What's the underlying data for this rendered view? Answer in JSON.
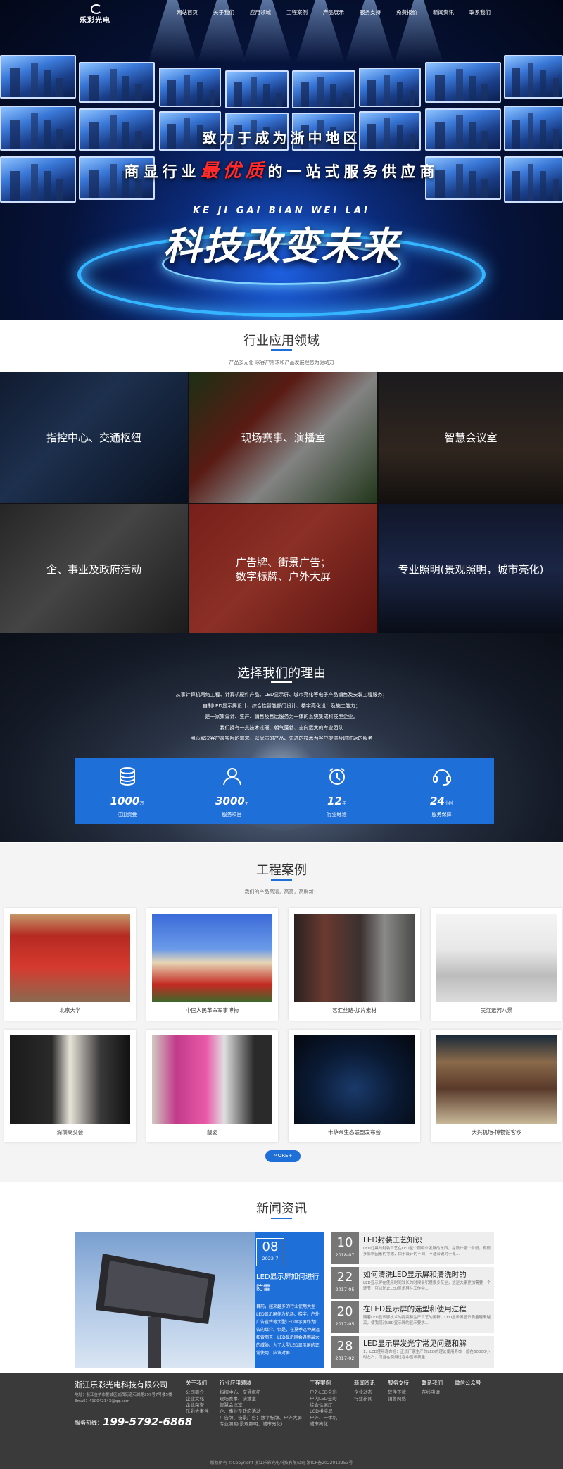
{
  "nav": {
    "logo": "乐彩光电",
    "items": [
      "网站首页",
      "关于我们",
      "应用领域",
      "工程案例",
      "产品展示",
      "服务支持",
      "免费报价",
      "新闻资讯",
      "联系我们"
    ]
  },
  "hero": {
    "line1": "致力于成为浙中地区",
    "line2_pre": "商显行业",
    "line2_hl": "最优质",
    "line2_post": "的一站式服务供应商",
    "pinyin": "KE JI GAI BIAN WEI LAI",
    "big": "科技改变未来"
  },
  "apps": {
    "title": "行业应用领域",
    "subtitle": "产品多元化 以客户需求和产品发展理念为驱动力",
    "tiles": [
      {
        "label": "指控中心、交通枢纽"
      },
      {
        "label": "现场赛事、演播室"
      },
      {
        "label": "智慧会议室"
      },
      {
        "label": "企、事业及政府活动"
      },
      {
        "label_1": "广告牌、街景广告；",
        "label_2": "数字标牌、户外大屏"
      },
      {
        "label": "专业照明(景观照明，城市亮化)"
      }
    ]
  },
  "why": {
    "title": "选择我们的理由",
    "lines": [
      "从事计算机网络工程、计算机硬件产品、LED显示屏、城市亮化等电子产品销售及安装工程服务；",
      "自制LED显示屏设计、综合性智能部门设计、楼宇亮化设计及施工能力；",
      "是一家集设计、生产、销售及售后服务为一体的系统集成科技型企业。",
      "我们拥有一支技术过硬、朝气蓬勃、志向远大的专业团队",
      "用心解决客户最实际的需求，以优质的产品、先进的技术为客户提供及时往返的服务"
    ],
    "stats": [
      {
        "num": "1000",
        "unit": "万",
        "label": "注册资金",
        "icon": "coins-icon"
      },
      {
        "num": "3000",
        "unit": "+",
        "label": "服务项目",
        "icon": "users-icon"
      },
      {
        "num": "12",
        "unit": "年",
        "label": "行业经验",
        "icon": "clock-icon"
      },
      {
        "num": "24",
        "unit": "小时",
        "label": "服务保障",
        "icon": "support-icon"
      }
    ]
  },
  "cases": {
    "title": "工程案例",
    "subtitle": "我们的产品高清，高亮，高刷新！",
    "items": [
      "北京大学",
      "中国人民革命军事博物",
      "艺汇丝路-加片素材",
      "吴江运河八景",
      "深圳高交会",
      "靓姿",
      "卡萨帝生态联盟发布会",
      "大兴机场-博物馆客移"
    ],
    "more": "MORE+"
  },
  "news": {
    "title": "新闻资讯",
    "feature": {
      "day": "08",
      "ym": "2022-7",
      "title": "LED显示屏如何进行防雷",
      "desc": "目前，越来越多的行业使用大型LED显示屏作为机场、楼宇、户外广告宣传等大型LED显示屏作为广告的媒介。但是，在夏季这种高温和雷雨天，LED显示屏会遇到最大的威胁。为了大型LED显示屏的正常使用，应该对屏..."
    },
    "list": [
      {
        "day": "10",
        "ym": "2018-07",
        "title": "LED封装工艺知识",
        "desc": "LED灯具的封装工艺在LED整个照明业发展的东西，在设计哪个阶段，有很多影响因素的考虑，由于设计的不同，不适合说对于某..."
      },
      {
        "day": "22",
        "ym": "2017-05",
        "title": "如何清洗LED显示屏和清洗时的",
        "desc": "LED显示屏在使用时间较长的时候会积攒很多灰尘，这是大家更加需要一个环节，可以防止LED显示屏在工作中..."
      },
      {
        "day": "20",
        "ym": "2017-05",
        "title": "在LED显示屏的选型和使用过程",
        "desc": "随着LED显示屏技术的提高和生产工艺的更新，LED显示屏显示质量越来越高，使我们对LED显示屏的显示要求..."
      },
      {
        "day": "28",
        "ym": "2017-02",
        "title": "LED显示屏发光字常见问题和解",
        "desc": "1、LED使用寿命短：正规厂家生产的LED的理论使用寿命一般在60000小时左右，而且在使用过程中显示质量..."
      }
    ]
  },
  "footer": {
    "company": "浙江乐彩光电科技有限公司",
    "address": "地址：浙江金华市婺城区城西街道石城路299号7号楼5楼",
    "email": "Email：410042143@qq.com",
    "tel_label": "服务热线：",
    "tel": "199-5792-6868",
    "cols": [
      {
        "h": "关于我们",
        "items": [
          "公司简介",
          "企业文化",
          "企业荣誉",
          "乐彩大事件"
        ]
      },
      {
        "h": "行业应用领域",
        "items": [
          "指挥中心、交通枢纽",
          "现场赛事、演播室",
          "智慧会议室",
          "企、事业及政府活动",
          "广告牌、街景广告；数字标牌、户外大屏",
          "专业照明(景观照明，城市亮化)"
        ]
      },
      {
        "h": "工程案例",
        "items": [
          "户外LED全彩",
          "户内LED全彩",
          "综合性展厅",
          "LCD拼接屏",
          "户外、一体机",
          "城市亮化"
        ]
      },
      {
        "h": "新闻资讯",
        "items": [
          "企业动态",
          "行业新闻"
        ]
      },
      {
        "h": "服务支持",
        "items": [
          "软件下载",
          "销售网络"
        ]
      },
      {
        "h": "联系我们",
        "items": [
          "在线申请"
        ]
      },
      {
        "h": "微信公众号",
        "items": []
      }
    ],
    "copyright": "版权所有 ©Copyright 浙江乐彩光电科技有限公司 浙ICP备2022012253号"
  }
}
